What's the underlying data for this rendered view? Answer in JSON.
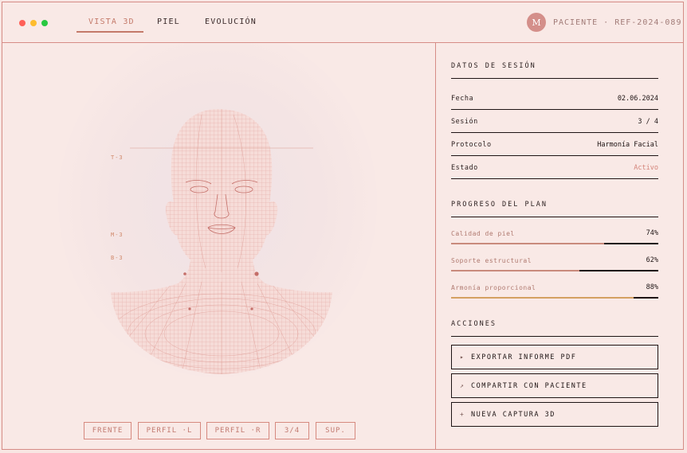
{
  "tabs": [
    {
      "label": "VISTA 3D",
      "active": true
    },
    {
      "label": "PIEL",
      "active": false
    },
    {
      "label": "EVOLUCIÓN",
      "active": false
    }
  ],
  "patient": {
    "avatar_initial": "M",
    "label": "PACIENTE · REF-2024-089"
  },
  "viewer": {
    "markers": [
      "T-3",
      "M-3",
      "B-3"
    ],
    "view_buttons": [
      "FRENTE",
      "PERFIL ·L",
      "PERFIL ·R",
      "3/4",
      "SUP."
    ]
  },
  "session": {
    "title": "DATOS DE SESIÓN",
    "rows": [
      {
        "label": "Fecha",
        "value": "02.06.2024"
      },
      {
        "label": "Sesión",
        "value": "3 / 4"
      },
      {
        "label": "Protocolo",
        "value": "Harmonía Facial"
      },
      {
        "label": "Estado",
        "value": "Activo"
      }
    ]
  },
  "plan": {
    "title": "PROGRESO DEL PLAN",
    "items": [
      {
        "label": "Calidad de piel",
        "pct_text": "74%",
        "fraction": 0.74,
        "color": "#c98a7c"
      },
      {
        "label": "Soporte estructural",
        "pct_text": "62%",
        "fraction": 0.62,
        "color": "#c98a7c"
      },
      {
        "label": "Armonía proporcional",
        "pct_text": "88%",
        "fraction": 0.88,
        "color": "#d4a062"
      }
    ]
  },
  "actions": {
    "title": "ACCIONES",
    "items": [
      {
        "icon": "▸",
        "icon_name": "play-icon",
        "label": "EXPORTAR INFORME PDF"
      },
      {
        "icon": "↗",
        "icon_name": "share-arrow-icon",
        "label": "COMPARTIR CON PACIENTE"
      },
      {
        "icon": "+",
        "icon_name": "plus-icon",
        "label": "NUEVA CAPTURA 3D"
      }
    ]
  },
  "colors": {
    "accent": "#c47a6a",
    "border": "#d68c86",
    "mesh": "#e0a09a",
    "background": "#f9e9e6"
  }
}
